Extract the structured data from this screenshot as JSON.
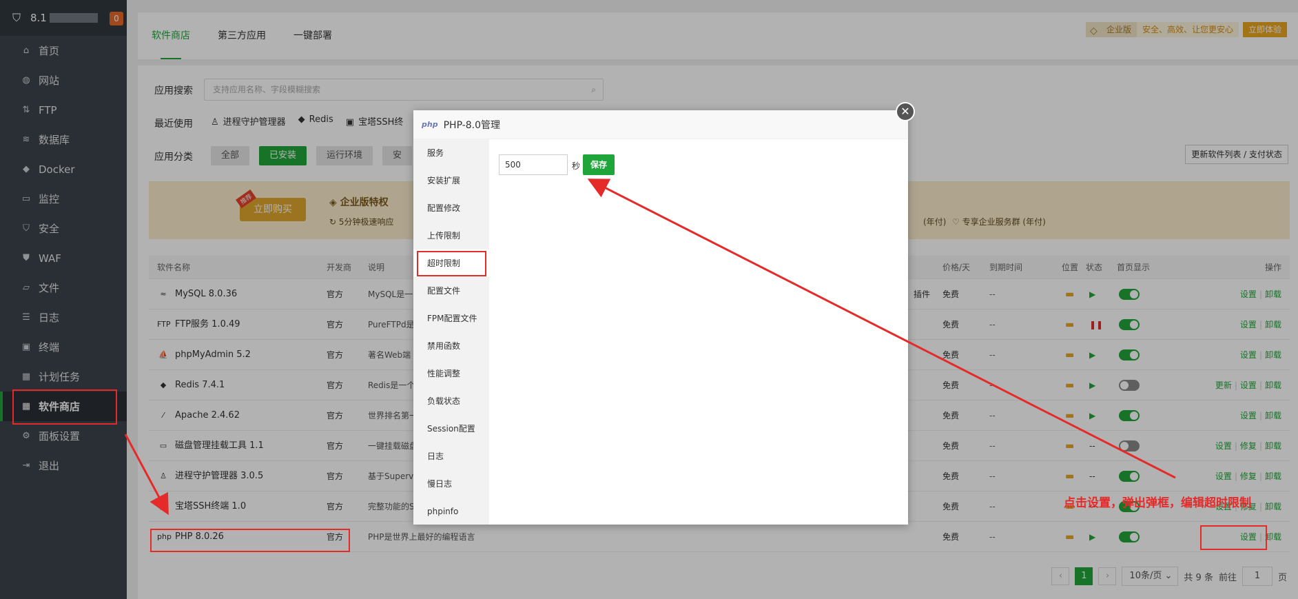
{
  "sidebar": {
    "ip": "8.1",
    "badge": "0",
    "items": [
      {
        "label": "首页",
        "icon": "home-icon",
        "glyph": "⌂"
      },
      {
        "label": "网站",
        "icon": "globe-icon",
        "glyph": "◍"
      },
      {
        "label": "FTP",
        "icon": "ftp-icon",
        "glyph": "⇅"
      },
      {
        "label": "数据库",
        "icon": "database-icon",
        "glyph": "≋"
      },
      {
        "label": "Docker",
        "icon": "docker-icon",
        "glyph": "◆"
      },
      {
        "label": "监控",
        "icon": "monitor-icon",
        "glyph": "▭"
      },
      {
        "label": "安全",
        "icon": "shield-icon",
        "glyph": "⛉"
      },
      {
        "label": "WAF",
        "icon": "waf-icon",
        "glyph": "⛊"
      },
      {
        "label": "文件",
        "icon": "folder-icon",
        "glyph": "▱"
      },
      {
        "label": "日志",
        "icon": "log-icon",
        "glyph": "☰"
      },
      {
        "label": "终端",
        "icon": "terminal-icon",
        "glyph": "▣"
      },
      {
        "label": "计划任务",
        "icon": "calendar-icon",
        "glyph": "▦"
      },
      {
        "label": "软件商店",
        "icon": "apps-icon",
        "glyph": "▦"
      },
      {
        "label": "面板设置",
        "icon": "gear-icon",
        "glyph": "⚙"
      },
      {
        "label": "退出",
        "icon": "logout-icon",
        "glyph": "⇥"
      }
    ]
  },
  "tabs": [
    "软件商店",
    "第三方应用",
    "一键部署"
  ],
  "promo": {
    "edition": "企业版",
    "slogan": "安全、高效、让您更安心",
    "try": "立即体验"
  },
  "search": {
    "label": "应用搜索",
    "placeholder": "支持应用名称、字段模糊搜索"
  },
  "recent": {
    "label": "最近使用",
    "items": [
      "进程守护管理器",
      "Redis",
      "宝塔SSH终"
    ]
  },
  "category": {
    "label": "应用分类",
    "buttons": [
      "全部",
      "已安装",
      "运行环境",
      "安"
    ]
  },
  "update_btn": "更新软件列表 / 支付状态",
  "banner": {
    "hot": "推荐",
    "buy": "立即购买",
    "title": "企业版特权",
    "f1": "5分钟极速响应",
    "f2": "(年付)",
    "f3": "专享企业服务群 (年付)"
  },
  "table": {
    "headers": {
      "name": "软件名称",
      "dev": "开发商",
      "desc": "说明",
      "price": "价格/天",
      "expire": "到期时间",
      "loc": "位置",
      "status": "状态",
      "home": "首页显示",
      "ops": "操作"
    },
    "rows": [
      {
        "name": "MySQL 8.0.36",
        "icon": "≈",
        "dev": "官方",
        "desc": "MySQL是一",
        "extra": "插件",
        "price": "免费",
        "expire": "--",
        "status": "▶",
        "stype": "play",
        "toggle": "on",
        "ops": [
          "设置",
          "卸载"
        ]
      },
      {
        "name": "FTP服务 1.0.49",
        "icon": "FTP",
        "dev": "官方",
        "desc": "PureFTPd是",
        "extra": "",
        "price": "免费",
        "expire": "--",
        "status": "❚❚",
        "stype": "pause",
        "toggle": "on",
        "ops": [
          "设置",
          "卸载"
        ]
      },
      {
        "name": "phpMyAdmin 5.2",
        "icon": "⛵",
        "dev": "官方",
        "desc": "著名Web端",
        "extra": "",
        "price": "免费",
        "expire": "--",
        "status": "▶",
        "stype": "play",
        "toggle": "on",
        "ops": [
          "设置",
          "卸载"
        ]
      },
      {
        "name": "Redis 7.4.1",
        "icon": "◆",
        "dev": "官方",
        "desc": "Redis是一个",
        "extra": "",
        "price": "免费",
        "expire": "--",
        "status": "▶",
        "stype": "play",
        "toggle": "off",
        "ops": [
          "更新",
          "设置",
          "卸载"
        ]
      },
      {
        "name": "Apache 2.4.62",
        "icon": "⁄",
        "dev": "官方",
        "desc": "世界排名第一",
        "extra": "",
        "price": "免费",
        "expire": "--",
        "status": "▶",
        "stype": "play",
        "toggle": "on",
        "ops": [
          "设置",
          "卸载"
        ]
      },
      {
        "name": "磁盘管理挂载工具 1.1",
        "icon": "▭",
        "dev": "官方",
        "desc": "一键挂载磁盘",
        "extra": "",
        "price": "免费",
        "expire": "--",
        "status": "--",
        "stype": "none",
        "toggle": "off",
        "ops": [
          "设置",
          "修复",
          "卸载"
        ]
      },
      {
        "name": "进程守护管理器 3.0.5",
        "icon": "♙",
        "dev": "官方",
        "desc": "基于Supervi",
        "extra": "",
        "price": "免费",
        "expire": "--",
        "status": "--",
        "stype": "none",
        "toggle": "on",
        "ops": [
          "设置",
          "修复",
          "卸载"
        ]
      },
      {
        "name": "宝塔SSH终端 1.0",
        "icon": "▣",
        "dev": "官方",
        "desc": "完整功能的S",
        "extra": "",
        "price": "免费",
        "expire": "--",
        "status": "--",
        "stype": "none",
        "toggle": "on",
        "ops": [
          "设置",
          "修复",
          "卸载"
        ]
      },
      {
        "name": "PHP 8.0.26",
        "icon": "php",
        "dev": "官方",
        "desc": "PHP是世界上最好的编程语言",
        "extra": "",
        "price": "免费",
        "expire": "--",
        "status": "▶",
        "stype": "play",
        "toggle": "on",
        "ops": [
          "设置",
          "卸载"
        ]
      }
    ]
  },
  "pager": {
    "page": "1",
    "size": "10条/页",
    "total": "共 9 条",
    "goto": "前往",
    "goto_val": "1",
    "unit": "页"
  },
  "modal": {
    "title": "PHP-8.0管理",
    "logo": "php",
    "menu": [
      "服务",
      "安装扩展",
      "配置修改",
      "上传限制",
      "超时限制",
      "配置文件",
      "FPM配置文件",
      "禁用函数",
      "性能调整",
      "负载状态",
      "Session配置",
      "日志",
      "慢日志",
      "phpinfo"
    ],
    "active_index": 4,
    "timeout_value": "500",
    "unit": "秒",
    "save": "保存"
  },
  "annotation": "点击设置，弹出弹框，编辑超时限制",
  "colors": {
    "accent": "#20a53a",
    "annotation": "#e52a2a",
    "sidebar": "#3c444d"
  }
}
